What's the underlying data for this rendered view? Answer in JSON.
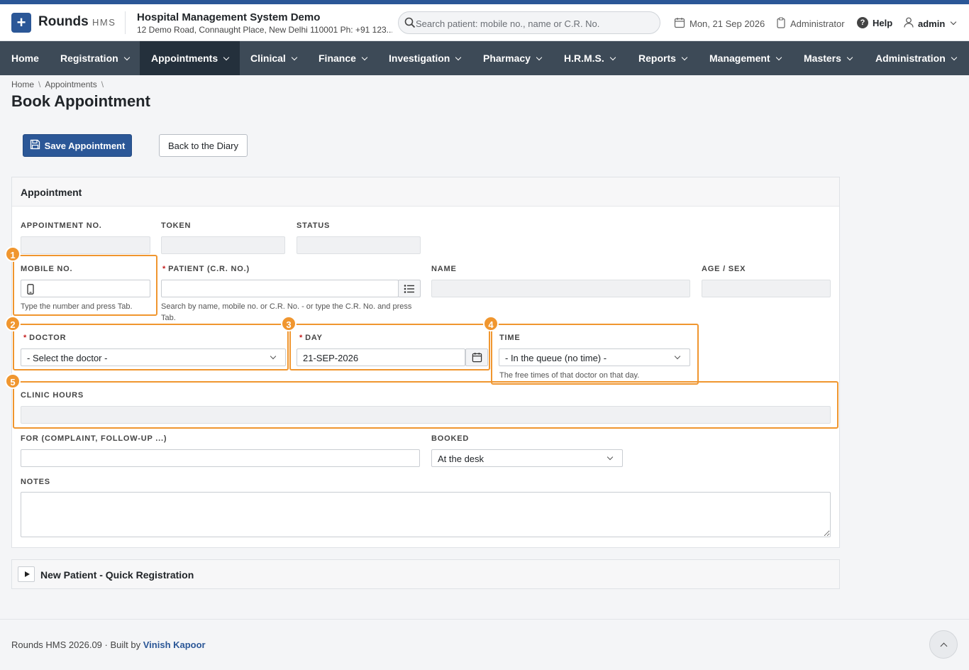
{
  "app": {
    "brand": "Rounds",
    "brand_sub": "HMS",
    "org_name": "Hospital Management System Demo",
    "org_address": "12 Demo Road, Connaught Place, New Delhi 110001 Ph: +91 123...",
    "accent_color": "#2b5797",
    "highlight_color": "#f0962f"
  },
  "search": {
    "placeholder": "Search patient: mobile no., name or C.R. No."
  },
  "topbar": {
    "date": "Mon, 21 Sep 2026",
    "role": "Administrator",
    "help": "Help",
    "user": "admin"
  },
  "nav": [
    {
      "label": "Home"
    },
    {
      "label": "Registration"
    },
    {
      "label": "Appointments"
    },
    {
      "label": "Clinical"
    },
    {
      "label": "Finance"
    },
    {
      "label": "Investigation"
    },
    {
      "label": "Pharmacy"
    },
    {
      "label": "H.R.M.S."
    },
    {
      "label": "Reports"
    },
    {
      "label": "Management"
    },
    {
      "label": "Masters"
    },
    {
      "label": "Administration"
    }
  ],
  "breadcrumb": [
    "Home",
    "Appointments"
  ],
  "page_title": "Book Appointment",
  "buttons": {
    "save": "Save Appointment",
    "back": "Back to the Diary"
  },
  "card": {
    "title": "Appointment",
    "appointment_no_label": "APPOINTMENT NO.",
    "token_label": "TOKEN",
    "status_label": "STATUS",
    "mobile_label": "MOBILE NO.",
    "mobile_help": "Type the number and press Tab.",
    "patient_label": "PATIENT (C.R. NO.)",
    "patient_help": "Search by name, mobile no. or C.R. No. - or type the C.R. No. and press Tab.",
    "name_label": "NAME",
    "age_sex_label": "AGE / SEX",
    "doctor_label": "DOCTOR",
    "doctor_value": "- Select the doctor -",
    "day_label": "DAY",
    "day_value": "21-SEP-2026",
    "time_label": "TIME",
    "time_value": "- In the queue (no time) -",
    "time_help": "The free times of that doctor on that day.",
    "clinic_hours_label": "CLINIC HOURS",
    "for_label": "FOR (COMPLAINT, FOLLOW-UP ...)",
    "booked_label": "BOOKED",
    "booked_value": "At the desk",
    "notes_label": "NOTES"
  },
  "callouts": [
    "1",
    "2",
    "3",
    "4",
    "5"
  ],
  "quick_reg": {
    "title": "New Patient - Quick Registration"
  },
  "footer": {
    "text": "Rounds HMS 2026.09 · Built by",
    "author": "Vinish Kapoor"
  }
}
